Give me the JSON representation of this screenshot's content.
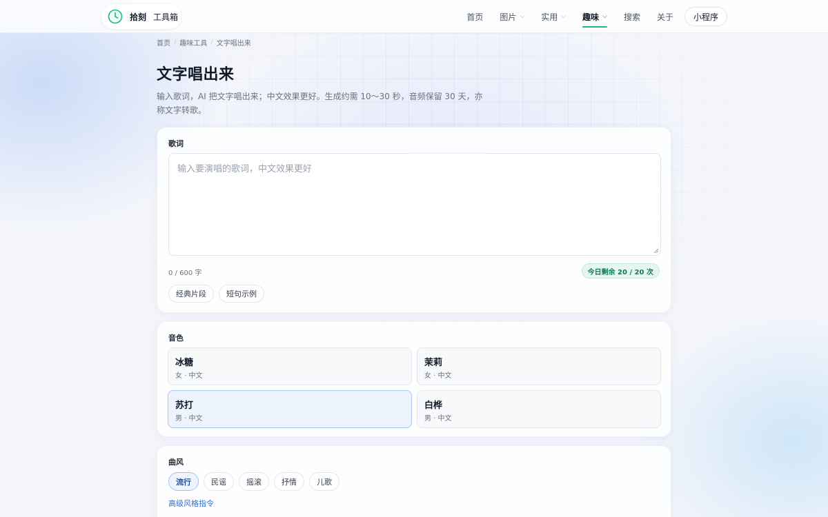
{
  "header": {
    "brand_name": "拾刻",
    "brand_sub": "工具箱",
    "nav": [
      {
        "label": "首页",
        "has_menu": false
      },
      {
        "label": "图片",
        "has_menu": true
      },
      {
        "label": "实用",
        "has_menu": true
      },
      {
        "label": "趣味",
        "has_menu": true,
        "active": true
      },
      {
        "label": "搜索",
        "has_menu": false
      },
      {
        "label": "关于",
        "has_menu": false
      }
    ],
    "mini_program": "小程序"
  },
  "breadcrumb": [
    "首页",
    "趣味工具",
    "文字唱出来"
  ],
  "page": {
    "title": "文字唱出来",
    "description": "输入歌词，AI 把文字唱出来；中文效果更好。生成约需 10～30 秒，音频保留 30 天，亦称文字转歌。"
  },
  "lyrics": {
    "label": "歌词",
    "placeholder": "输入要演唱的歌词，中文效果更好",
    "count": "0 / 600 字",
    "quota": "今日剩余 20 / 20 次",
    "examples": [
      "经典片段",
      "短句示例"
    ]
  },
  "voice": {
    "label": "音色",
    "options": [
      {
        "name": "冰糖",
        "meta": "女 · 中文",
        "selected": false
      },
      {
        "name": "茉莉",
        "meta": "女 · 中文",
        "selected": false
      },
      {
        "name": "苏打",
        "meta": "男 · 中文",
        "selected": true
      },
      {
        "name": "白桦",
        "meta": "男 · 中文",
        "selected": false
      }
    ]
  },
  "style": {
    "label": "曲风",
    "options": [
      "流行",
      "民谣",
      "摇滚",
      "抒情",
      "儿歌"
    ],
    "selected": "流行",
    "advanced_link": "高级风格指令"
  },
  "colors": {
    "accent_green": "#22b58a",
    "selected_blue": "#a9c9f2",
    "link_blue": "#2f6fd6",
    "quota_bg": "#e4f6ef"
  }
}
